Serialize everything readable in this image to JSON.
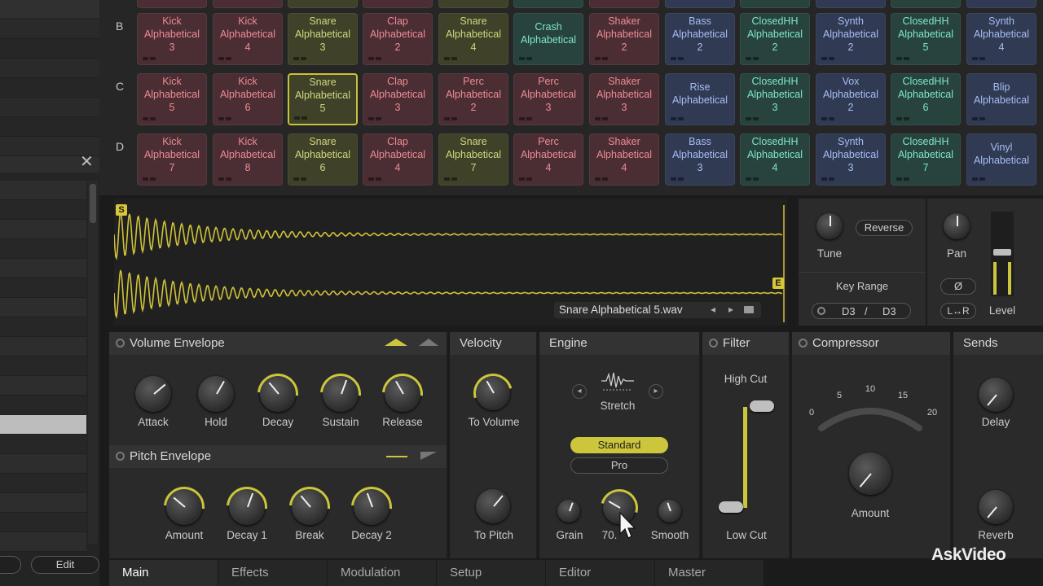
{
  "sidebar": {
    "edit_label": "Edit",
    "close_symbol": "✕"
  },
  "grid": {
    "rows": [
      "B",
      "C",
      "D"
    ],
    "pads": [
      [
        {
          "lines": [
            "Kick",
            "Alphabetical",
            "3"
          ],
          "color": "red"
        },
        {
          "lines": [
            "Kick",
            "Alphabetical",
            "4"
          ],
          "color": "red"
        },
        {
          "lines": [
            "Snare",
            "Alphabetical",
            "3"
          ],
          "color": "yellow"
        },
        {
          "lines": [
            "Clap",
            "Alphabetical",
            "2"
          ],
          "color": "red"
        },
        {
          "lines": [
            "Snare",
            "Alphabetical",
            "4"
          ],
          "color": "yellow"
        },
        {
          "lines": [
            "Crash",
            "Alphabetical",
            ""
          ],
          "color": "teal"
        },
        {
          "lines": [
            "Shaker",
            "Alphabetical",
            "2"
          ],
          "color": "red"
        },
        {
          "lines": [
            "Bass",
            "Alphabetical",
            "2"
          ],
          "color": "blue"
        },
        {
          "lines": [
            "ClosedHH",
            "Alphabetical",
            "2"
          ],
          "color": "teal"
        },
        {
          "lines": [
            "Synth",
            "Alphabetical",
            "2"
          ],
          "color": "blue"
        },
        {
          "lines": [
            "ClosedHH",
            "Alphabetical",
            "5"
          ],
          "color": "teal"
        },
        {
          "lines": [
            "Synth",
            "Alphabetical",
            "4"
          ],
          "color": "blue"
        }
      ],
      [
        {
          "lines": [
            "Kick",
            "Alphabetical",
            "5"
          ],
          "color": "red"
        },
        {
          "lines": [
            "Kick",
            "Alphabetical",
            "6"
          ],
          "color": "red"
        },
        {
          "lines": [
            "Snare",
            "Alphabetical",
            "5"
          ],
          "color": "yellow",
          "selected": true
        },
        {
          "lines": [
            "Clap",
            "Alphabetical",
            "3"
          ],
          "color": "red"
        },
        {
          "lines": [
            "Perc",
            "Alphabetical",
            "2"
          ],
          "color": "red"
        },
        {
          "lines": [
            "Perc",
            "Alphabetical",
            "3"
          ],
          "color": "red"
        },
        {
          "lines": [
            "Shaker",
            "Alphabetical",
            "3"
          ],
          "color": "red"
        },
        {
          "lines": [
            "Rise",
            "Alphabetical",
            ""
          ],
          "color": "blue"
        },
        {
          "lines": [
            "ClosedHH",
            "Alphabetical",
            "3"
          ],
          "color": "teal"
        },
        {
          "lines": [
            "Vox",
            "Alphabetical",
            "2"
          ],
          "color": "blue"
        },
        {
          "lines": [
            "ClosedHH",
            "Alphabetical",
            "6"
          ],
          "color": "teal"
        },
        {
          "lines": [
            "Blip",
            "Alphabetical",
            ""
          ],
          "color": "blue"
        }
      ],
      [
        {
          "lines": [
            "Kick",
            "Alphabetical",
            "7"
          ],
          "color": "red"
        },
        {
          "lines": [
            "Kick",
            "Alphabetical",
            "8"
          ],
          "color": "red"
        },
        {
          "lines": [
            "Snare",
            "Alphabetical",
            "6"
          ],
          "color": "yellow"
        },
        {
          "lines": [
            "Clap",
            "Alphabetical",
            "4"
          ],
          "color": "red"
        },
        {
          "lines": [
            "Snare",
            "Alphabetical",
            "7"
          ],
          "color": "yellow"
        },
        {
          "lines": [
            "Perc",
            "Alphabetical",
            "4"
          ],
          "color": "red"
        },
        {
          "lines": [
            "Shaker",
            "Alphabetical",
            "4"
          ],
          "color": "red"
        },
        {
          "lines": [
            "Bass",
            "Alphabetical",
            "3"
          ],
          "color": "blue"
        },
        {
          "lines": [
            "ClosedHH",
            "Alphabetical",
            "4"
          ],
          "color": "teal"
        },
        {
          "lines": [
            "Synth",
            "Alphabetical",
            "3"
          ],
          "color": "blue"
        },
        {
          "lines": [
            "ClosedHH",
            "Alphabetical",
            "7"
          ],
          "color": "teal"
        },
        {
          "lines": [
            "Vinyl",
            "Alphabetical",
            ""
          ],
          "color": "blue"
        }
      ]
    ]
  },
  "sample": {
    "start_marker": "S",
    "end_marker": "E",
    "file_name": "Snare Alphabetical 5.wav",
    "prev_symbol": "◂",
    "next_symbol": "▸",
    "wave_color": "#cfc23a"
  },
  "tune_panel": {
    "tune_label": "Tune",
    "reverse_label": "Reverse",
    "key_range_label": "Key Range",
    "key_low": "D3",
    "key_separator": "/",
    "key_high": "D3"
  },
  "pan_panel": {
    "pan_label": "Pan",
    "phase_symbol": "Ø",
    "lr_label": "L↔R",
    "level_label": "Level"
  },
  "volume_envelope": {
    "title": "Volume Envelope",
    "knobs": [
      "Attack",
      "Hold",
      "Decay",
      "Sustain",
      "Release"
    ]
  },
  "pitch_envelope": {
    "title": "Pitch Envelope",
    "knobs": [
      "Amount",
      "Decay 1",
      "Break",
      "Decay 2"
    ]
  },
  "velocity": {
    "title": "Velocity",
    "to_volume": "To Volume",
    "to_pitch": "To Pitch"
  },
  "engine": {
    "title": "Engine",
    "mode_label": "Stretch",
    "standard_label": "Standard",
    "pro_label": "Pro",
    "grain_label": "Grain",
    "value_label": "70.",
    "smooth_label": "Smooth"
  },
  "filter": {
    "title": "Filter",
    "high_cut": "High Cut",
    "low_cut": "Low Cut"
  },
  "compressor": {
    "title": "Compressor",
    "scale": [
      "0",
      "5",
      "10",
      "15",
      "20"
    ],
    "amount_label": "Amount"
  },
  "sends": {
    "title": "Sends",
    "delay_label": "Delay",
    "reverb_label": "Reverb"
  },
  "tabs": [
    "Main",
    "Effects",
    "Modulation",
    "Setup",
    "Editor",
    "Master"
  ],
  "watermark": "AskVideo"
}
